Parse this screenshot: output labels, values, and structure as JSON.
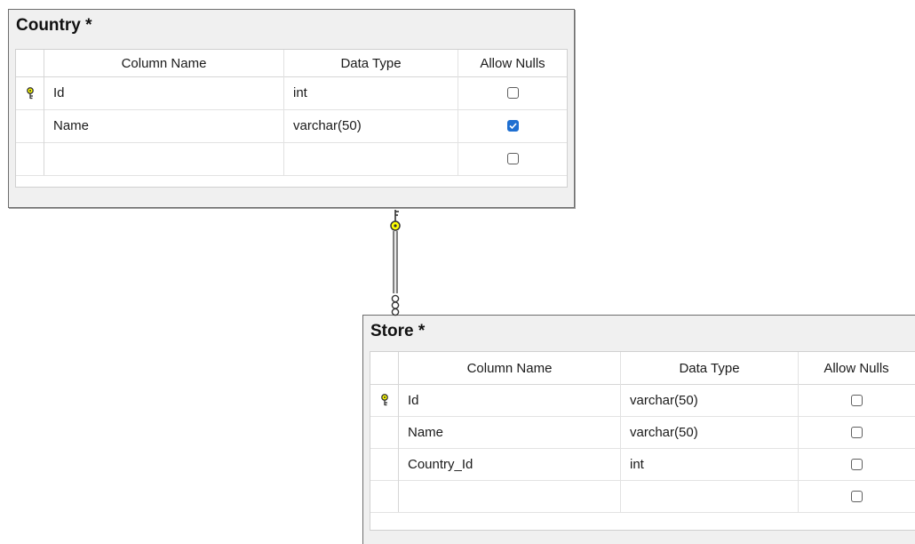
{
  "tables": [
    {
      "title": "Country *",
      "headers": {
        "column_name": "Column Name",
        "data_type": "Data Type",
        "allow_nulls": "Allow Nulls"
      },
      "rows": [
        {
          "column_name": "Id",
          "data_type": "int",
          "allow_nulls": false,
          "primary_key": true
        },
        {
          "column_name": "Name",
          "data_type": "varchar(50)",
          "allow_nulls": true,
          "primary_key": false
        },
        {
          "column_name": "",
          "data_type": "",
          "allow_nulls": false,
          "primary_key": false
        }
      ]
    },
    {
      "title": "Store *",
      "headers": {
        "column_name": "Column Name",
        "data_type": "Data Type",
        "allow_nulls": "Allow Nulls"
      },
      "rows": [
        {
          "column_name": "Id",
          "data_type": "varchar(50)",
          "allow_nulls": false,
          "primary_key": true
        },
        {
          "column_name": "Name",
          "data_type": "varchar(50)",
          "allow_nulls": false,
          "primary_key": false
        },
        {
          "column_name": "Country_Id",
          "data_type": "int",
          "allow_nulls": false,
          "primary_key": false
        },
        {
          "column_name": "",
          "data_type": "",
          "allow_nulls": false,
          "primary_key": false
        }
      ]
    }
  ],
  "relationship": {
    "from_end_icon": "key-icon",
    "to_end_icon": "infinity-icon",
    "color": "#ffff00"
  },
  "colors": {
    "checked": "#1f6fd1",
    "key": "#e8d300"
  }
}
